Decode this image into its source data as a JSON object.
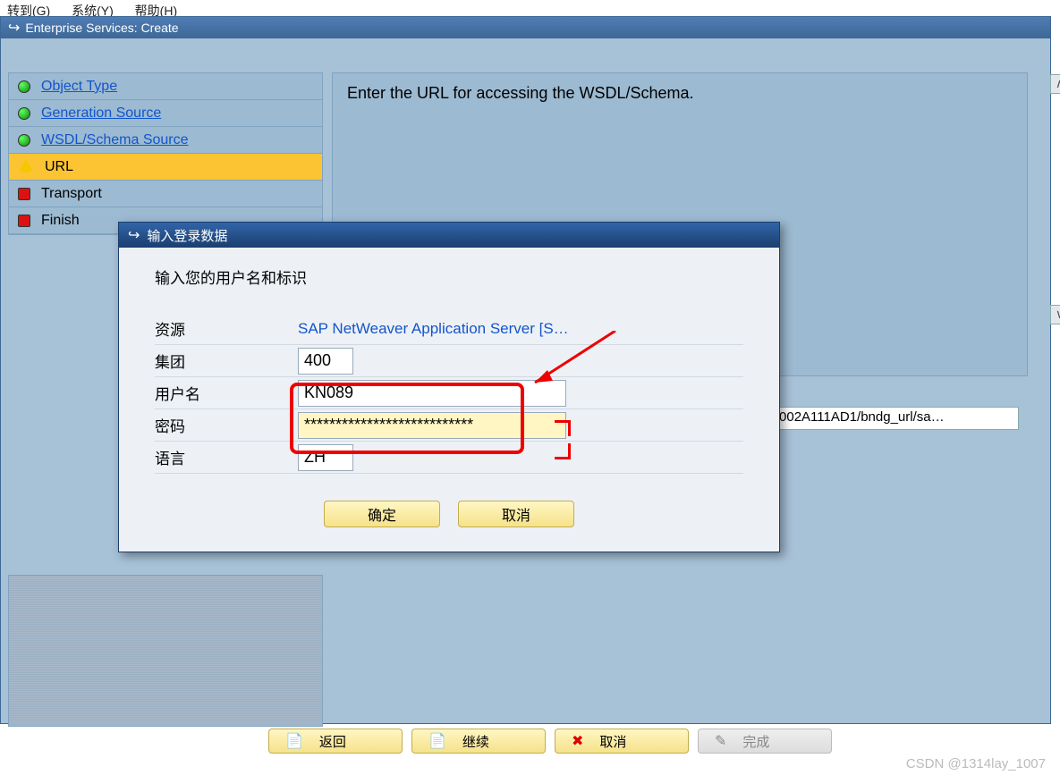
{
  "menu": {
    "jump": "转到(G)",
    "system": "系统(Y)",
    "help": "帮助(H)"
  },
  "window": {
    "title": "Enterprise Services: Create"
  },
  "steps": [
    {
      "label": "Object Type",
      "state": "green",
      "link": true,
      "selected": false
    },
    {
      "label": "Generation Source",
      "state": "green",
      "link": true,
      "selected": false
    },
    {
      "label": "WSDL/Schema Source",
      "state": "green",
      "link": true,
      "selected": false
    },
    {
      "label": "URL",
      "state": "yellow",
      "link": false,
      "selected": true
    },
    {
      "label": "Transport",
      "state": "red",
      "link": false,
      "selected": false
    },
    {
      "label": "Finish",
      "state": "red",
      "link": false,
      "selected": false
    }
  ],
  "right_pane": {
    "instruction": "Enter the URL for accessing the WSDL/Schema."
  },
  "url_field": {
    "value": "_10002A111AD1/bndg_url/sa…"
  },
  "dialog": {
    "title": "输入登录数据",
    "prompt": "输入您的用户名和标识",
    "resource_label": "资源",
    "resource_value": "SAP NetWeaver Application Server [S…",
    "client_label": "集团",
    "client_value": "400",
    "user_label": "用户名",
    "user_value": "KN089",
    "password_label": "密码",
    "password_value": "***************************",
    "lang_label": "语言",
    "lang_value": "ZH",
    "ok": "确定",
    "cancel": "取消"
  },
  "buttons": {
    "back": "返回",
    "continue": "继续",
    "cancel": "取消",
    "finish": "完成"
  },
  "watermark": "CSDN @1314lay_1007"
}
